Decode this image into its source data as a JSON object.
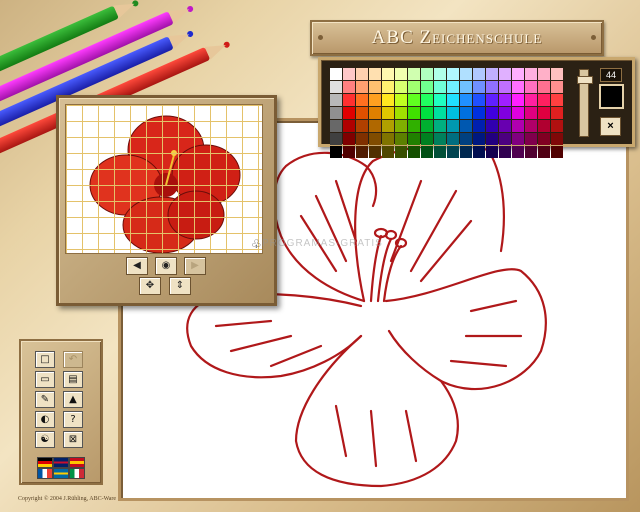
{
  "app": {
    "title": "ABC Zeichenschule",
    "copyright": "Copyright © 2004 J.Rühling, ABC-Ware"
  },
  "watermark": "PROGRAMAS-GRATIS",
  "palette": {
    "brush_size": "44",
    "current_color": "#000000",
    "close_label": "×",
    "colors": [
      [
        "#ffffff",
        "#ffc8c8",
        "#ffd0b0",
        "#ffe0b0",
        "#fff8b0",
        "#f0ffb0",
        "#d0ffb0",
        "#b0ffc0",
        "#b0ffe8",
        "#b0f8ff",
        "#b0e0ff",
        "#b0c8ff",
        "#c0b0ff",
        "#e0b0ff",
        "#ffb0ff",
        "#ffb0e0",
        "#ffb0c8",
        "#ffc0c0"
      ],
      [
        "#e0e0e0",
        "#ff8080",
        "#ffa070",
        "#ffc070",
        "#fff070",
        "#d8ff70",
        "#a0ff70",
        "#70ff90",
        "#70ffd8",
        "#70f0ff",
        "#70c0ff",
        "#7090ff",
        "#9070ff",
        "#c070ff",
        "#ff70ff",
        "#ff70c0",
        "#ff7090",
        "#ff9090"
      ],
      [
        "#b8b8b8",
        "#ff3030",
        "#ff7020",
        "#ffa020",
        "#ffe820",
        "#c0ff20",
        "#60ff20",
        "#20ff60",
        "#20ffc0",
        "#20e0ff",
        "#2090ff",
        "#2050ff",
        "#6020ff",
        "#a020ff",
        "#ff20ff",
        "#ff20a0",
        "#ff2060",
        "#ff4040"
      ],
      [
        "#909090",
        "#e00000",
        "#e05000",
        "#e08000",
        "#e0c800",
        "#a0e000",
        "#40e000",
        "#00e040",
        "#00e0a0",
        "#00c0e0",
        "#0070e0",
        "#0030e0",
        "#4000e0",
        "#8000e0",
        "#e000e0",
        "#e00080",
        "#e00040",
        "#e02020"
      ],
      [
        "#686868",
        "#b00000",
        "#b04000",
        "#b06800",
        "#b0a000",
        "#80b000",
        "#30b000",
        "#00b030",
        "#00b080",
        "#0098b0",
        "#0058b0",
        "#0020b0",
        "#3000b0",
        "#6800b0",
        "#b000b0",
        "#b00068",
        "#b00030",
        "#b01010"
      ],
      [
        "#404040",
        "#800000",
        "#803000",
        "#804c00",
        "#807400",
        "#5c8000",
        "#208000",
        "#008020",
        "#00805c",
        "#006e80",
        "#004080",
        "#001880",
        "#220080",
        "#4c0080",
        "#800080",
        "#80004c",
        "#800022",
        "#800808"
      ],
      [
        "#000000",
        "#500000",
        "#501c00",
        "#503000",
        "#504800",
        "#385000",
        "#145000",
        "#005014",
        "#005038",
        "#004450",
        "#002850",
        "#000e50",
        "#140050",
        "#300050",
        "#500050",
        "#500030",
        "#500014",
        "#500000"
      ]
    ]
  },
  "template_window": {
    "buttons": [
      {
        "name": "template-prev-button",
        "icon": "◀",
        "disabled": false
      },
      {
        "name": "template-show-button",
        "icon": "◉",
        "disabled": false
      },
      {
        "name": "template-next-button",
        "icon": "▶",
        "disabled": true
      },
      {
        "name": "template-move-button",
        "icon": "✥",
        "disabled": false
      },
      {
        "name": "template-resize-button",
        "icon": "⇕",
        "disabled": false
      }
    ]
  },
  "toolbox": {
    "tools": [
      {
        "name": "new-button",
        "icon": "□",
        "disabled": false
      },
      {
        "name": "undo-button",
        "icon": "↶",
        "disabled": true
      },
      {
        "name": "open-button",
        "icon": "▭",
        "disabled": false
      },
      {
        "name": "save-button",
        "icon": "▤",
        "disabled": false
      },
      {
        "name": "pencil-tool-button",
        "icon": "✎",
        "disabled": false
      },
      {
        "name": "picture-button",
        "icon": "▲",
        "disabled": false
      },
      {
        "name": "speaker-button",
        "icon": "◐",
        "disabled": false
      },
      {
        "name": "help-button",
        "icon": "?",
        "disabled": false
      },
      {
        "name": "settings-button",
        "icon": "☯",
        "disabled": false
      },
      {
        "name": "exit-button",
        "icon": "⊠",
        "disabled": false
      }
    ],
    "flags": [
      {
        "name": "flag-german",
        "colors": [
          "#000000",
          "#dd0000",
          "#ffce00"
        ],
        "dir": "h"
      },
      {
        "name": "flag-english",
        "colors": [
          "#012169",
          "#ffffff",
          "#c8102e"
        ],
        "dir": "uk"
      },
      {
        "name": "flag-spanish",
        "colors": [
          "#c60b1e",
          "#ffc400",
          "#c60b1e"
        ],
        "dir": "h"
      },
      {
        "name": "flag-french",
        "colors": [
          "#0055a4",
          "#ffffff",
          "#ef4135"
        ],
        "dir": "v"
      },
      {
        "name": "flag-swedish",
        "colors": [
          "#006aa7",
          "#fecc00"
        ],
        "dir": "nordic"
      },
      {
        "name": "flag-italian",
        "colors": [
          "#009246",
          "#ffffff",
          "#ce2b37"
        ],
        "dir": "v"
      }
    ]
  },
  "colors": {
    "outline_red": "#b0181a",
    "flower_red": "#d8261a",
    "grid_yellow": "#e4c26a"
  }
}
